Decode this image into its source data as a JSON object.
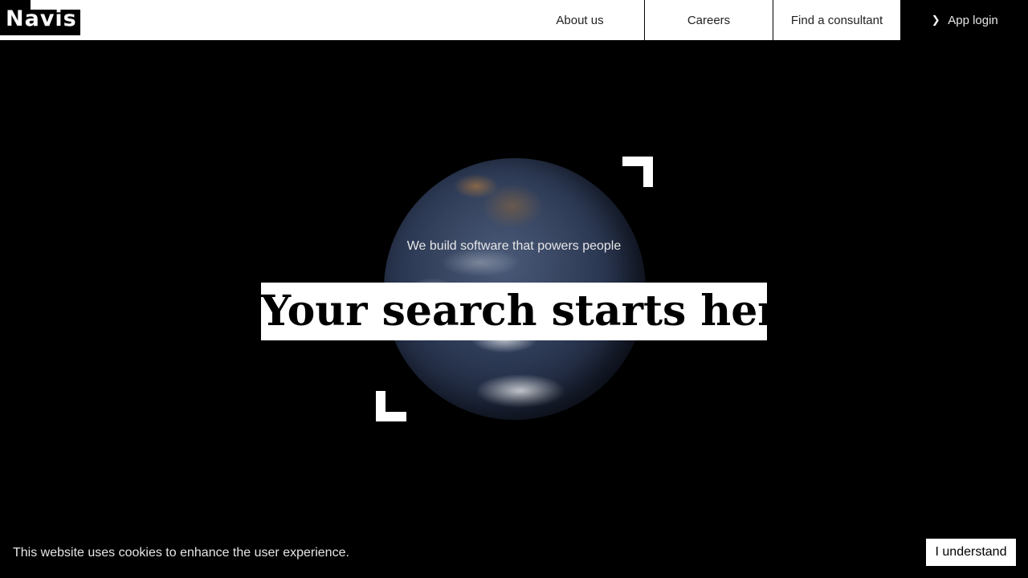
{
  "brand": {
    "logo_text": "Navis"
  },
  "nav": {
    "items": [
      {
        "label": "About us"
      },
      {
        "label": "Careers"
      },
      {
        "label": "Find a consultant"
      }
    ],
    "login": {
      "label": "App login",
      "icon": "chevron-right-icon"
    }
  },
  "hero": {
    "tagline": "We build software that powers people",
    "headline": "Your search starts here"
  },
  "cookie": {
    "message": "This website uses cookies to enhance the user experience.",
    "button_label": "I understand"
  },
  "colors": {
    "background": "#000000",
    "header_background": "#ffffff",
    "accent": "#ffffff"
  }
}
